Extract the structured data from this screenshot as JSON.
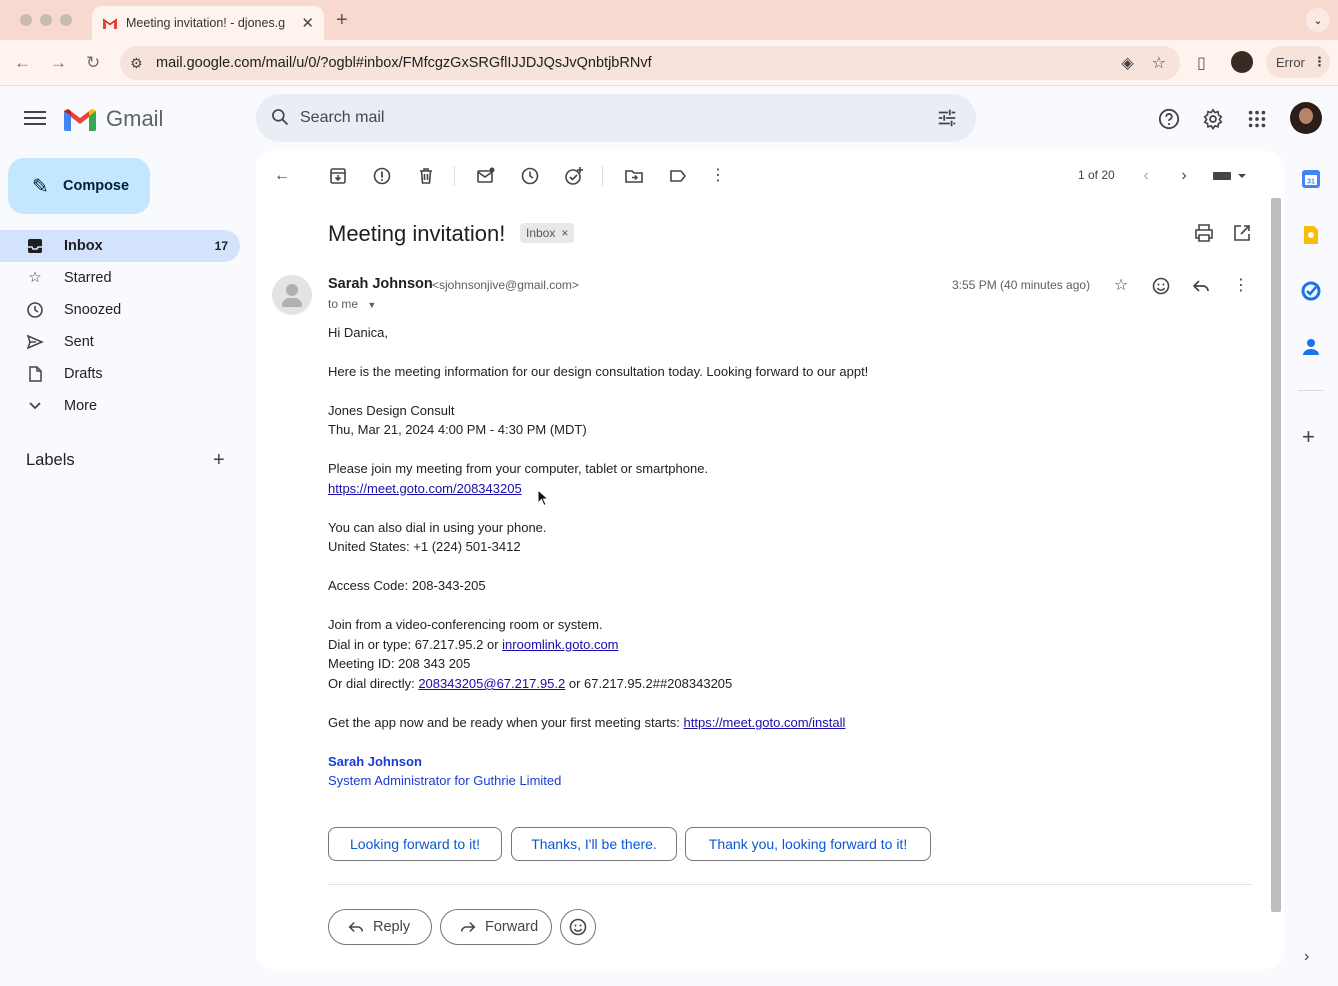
{
  "browser": {
    "tab_title": "Meeting invitation! - djones.g",
    "url": "mail.google.com/mail/u/0/?ogbl#inbox/FMfcgzGxSRGflIJJDJQsJvQnbtjbRNvf",
    "error_label": "Error"
  },
  "gmail": {
    "app_name": "Gmail",
    "search_placeholder": "Search mail"
  },
  "sidebar": {
    "compose_label": "Compose",
    "items": [
      {
        "label": "Inbox",
        "count": "17",
        "icon": "inbox-icon"
      },
      {
        "label": "Starred",
        "icon": "star-icon"
      },
      {
        "label": "Snoozed",
        "icon": "clock-icon"
      },
      {
        "label": "Sent",
        "icon": "send-icon"
      },
      {
        "label": "Drafts",
        "icon": "draft-icon"
      },
      {
        "label": "More",
        "icon": "chevron-down-icon"
      }
    ],
    "labels_title": "Labels"
  },
  "toolbar": {
    "pager": "1 of 20"
  },
  "email": {
    "subject": "Meeting invitation!",
    "chip": "Inbox",
    "sender_name": "Sarah Johnson",
    "sender_email": "<sjohnsonjive@gmail.com>",
    "to": "to me",
    "timestamp": "3:55 PM (40 minutes ago)",
    "greeting": "Hi Danica,",
    "intro": "Here is the meeting information for our design consultation today. Looking forward to our appt!",
    "meeting_name": "Jones Design Consult",
    "meeting_time": "Thu, Mar 21, 2024 4:00 PM - 4:30 PM (MDT)",
    "join_text": "Please join my meeting from your computer, tablet or smartphone.",
    "join_link": "https://meet.goto.com/208343205",
    "dial_text": "You can also dial in using your phone.",
    "dial_us": "United States: +1 (224) 501-3412",
    "access_code": "Access Code: 208-343-205",
    "video_text": "Join from a video-conferencing room or system.",
    "dial_type_prefix": "Dial in or type: 67.217.95.2 or ",
    "dial_type_link": "inroomlink.goto.com",
    "meeting_id": "Meeting ID: 208 343 205",
    "dial_direct_prefix": "Or dial directly: ",
    "dial_direct_link": "208343205@67.217.95.2",
    "dial_direct_suffix": " or 67.217.95.2##208343205",
    "app_prefix": "Get the app now and be ready when your first meeting starts: ",
    "app_link": "https://meet.goto.com/install",
    "sig_name": "Sarah Johnson",
    "sig_title": "System Administrator for Guthrie Limited"
  },
  "smart_replies": [
    "Looking forward to it!",
    "Thanks, I'll be there.",
    "Thank you, looking forward to it!"
  ],
  "actions": {
    "reply": "Reply",
    "forward": "Forward"
  },
  "colors": {
    "accent": "#0b57d0",
    "compose_bg": "#c2e7ff",
    "active_nav": "#d3e3fd",
    "link": "#1a0dab"
  }
}
